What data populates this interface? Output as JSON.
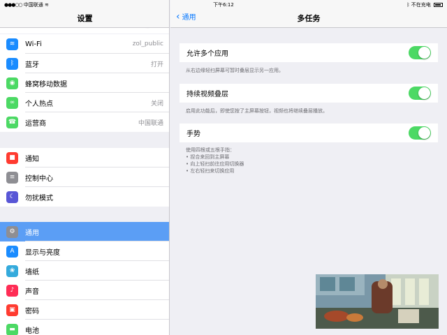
{
  "status_bar": {
    "carrier": "中国联通",
    "time": "下午6:12",
    "charging": "不在充电"
  },
  "sidebar": {
    "title": "设置",
    "group1": [
      {
        "label": "Wi-Fi",
        "value": "zol_public",
        "icon": "wifi-icon",
        "color": "#1a8cff"
      },
      {
        "label": "蓝牙",
        "value": "打开",
        "icon": "bluetooth-icon",
        "color": "#1a8cff"
      },
      {
        "label": "蜂窝移动数据",
        "value": "",
        "icon": "cellular-icon",
        "color": "#4cd964"
      },
      {
        "label": "个人热点",
        "value": "关闭",
        "icon": "hotspot-icon",
        "color": "#4cd964"
      },
      {
        "label": "运营商",
        "value": "中国联通",
        "icon": "phone-icon",
        "color": "#4cd964"
      }
    ],
    "group2": [
      {
        "label": "通知",
        "icon": "notifications-icon",
        "color": "#ff3b30"
      },
      {
        "label": "控制中心",
        "icon": "control-center-icon",
        "color": "#8e8e93"
      },
      {
        "label": "勿扰模式",
        "icon": "moon-icon",
        "color": "#5856d6"
      }
    ],
    "group3": [
      {
        "label": "通用",
        "icon": "gear-icon",
        "color": "#8e8e93"
      },
      {
        "label": "显示与亮度",
        "icon": "display-icon",
        "color": "#1a8cff"
      },
      {
        "label": "墙纸",
        "icon": "wallpaper-icon",
        "color": "#34aadc"
      },
      {
        "label": "声音",
        "icon": "sound-icon",
        "color": "#ff2d55"
      },
      {
        "label": "密码",
        "icon": "lock-icon",
        "color": "#ff3b30"
      },
      {
        "label": "电池",
        "icon": "battery-icon",
        "color": "#4cd964"
      }
    ]
  },
  "main": {
    "back_label": "通用",
    "title": "多任务",
    "settings": [
      {
        "label": "允许多个应用",
        "on": true,
        "footer": [
          "从右边缘轻扫屏幕可暂时叠层显示另一应用。"
        ]
      },
      {
        "label": "持续视频叠层",
        "on": true,
        "footer": [
          "启用此功能后，即使您按了主屏幕按钮，视频也将继续叠层播放。"
        ]
      },
      {
        "label": "手势",
        "on": true,
        "footer": [
          "使用四根或五根手指：",
          "• 捏合来回到主屏幕",
          "• 向上轻扫前往应用切换器",
          "• 左右轻扫来切换应用"
        ]
      }
    ]
  },
  "colors": {
    "accent": "#0a7aff",
    "toggle_on": "#4cd964",
    "selection": "#5b9ef5"
  }
}
